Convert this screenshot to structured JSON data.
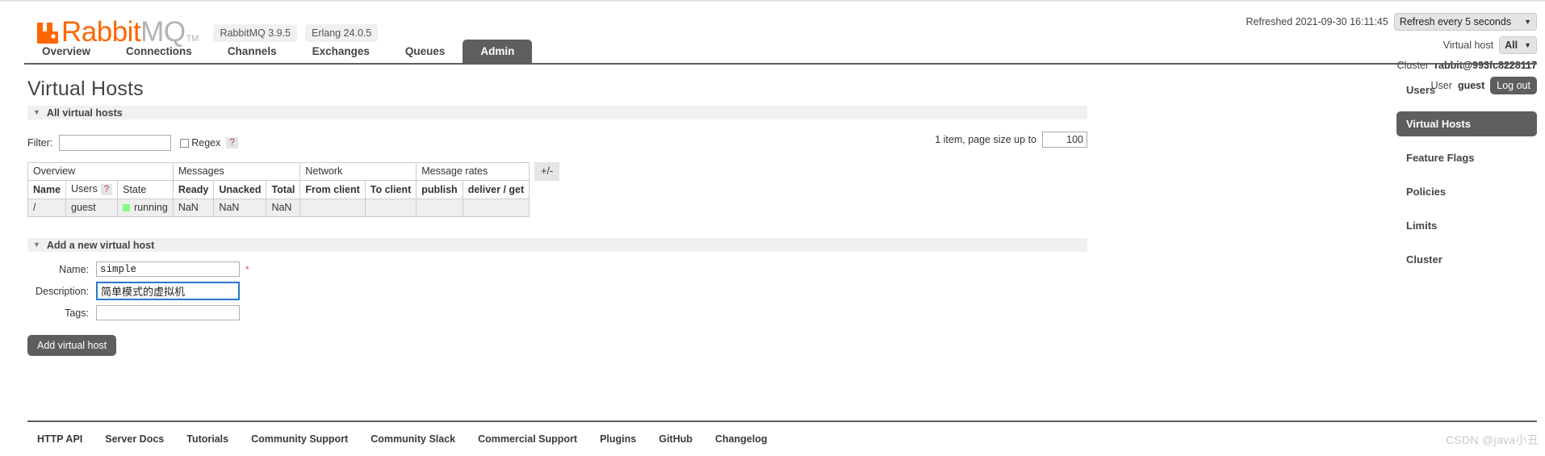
{
  "header": {
    "logo": {
      "brand_primary": "Rabbit",
      "brand_secondary": "MQ",
      "trademark": "TM",
      "icon": "rabbit-logo-icon"
    },
    "versions": {
      "rabbitmq": "RabbitMQ 3.9.5",
      "erlang": "Erlang 24.0.5"
    },
    "refreshed_text": "Refreshed 2021-09-30 16:11:45",
    "refresh_select": {
      "value": "Refresh every 5 seconds"
    },
    "vhost_label": "Virtual host",
    "vhost_select": {
      "value": "All"
    },
    "cluster_label": "Cluster",
    "cluster_name": "rabbit@993fc8228117",
    "user_label": "User",
    "user_name": "guest",
    "logout_label": "Log out"
  },
  "tabs": [
    {
      "label": "Overview",
      "active": false
    },
    {
      "label": "Connections",
      "active": false
    },
    {
      "label": "Channels",
      "active": false
    },
    {
      "label": "Exchanges",
      "active": false
    },
    {
      "label": "Queues",
      "active": false
    },
    {
      "label": "Admin",
      "active": true
    }
  ],
  "page": {
    "title": "Virtual Hosts"
  },
  "all_vhosts": {
    "section_title": "All virtual hosts",
    "filter_label": "Filter:",
    "filter_value": "",
    "filter_placeholder": "",
    "regex_label": "Regex",
    "regex_checked": false,
    "help_label": "?",
    "pager_text": "1 item, page size up to",
    "page_size": "100",
    "plus_minus_label": "+/-",
    "group_headers": [
      "Overview",
      "Messages",
      "Network",
      "Message rates"
    ],
    "columns": [
      "Name",
      "Users",
      "State",
      "Ready",
      "Unacked",
      "Total",
      "From client",
      "To client",
      "publish",
      "deliver / get"
    ],
    "users_help": "?",
    "rows": [
      {
        "name": "/",
        "users": "guest",
        "state": "running",
        "state_color": "#80ff80",
        "ready": "NaN",
        "unacked": "NaN",
        "total": "NaN",
        "from_client": "",
        "to_client": "",
        "publish": "",
        "deliver_get": ""
      }
    ]
  },
  "add_vhost": {
    "section_title": "Add a new virtual host",
    "fields": [
      {
        "label": "Name:",
        "value": "simple",
        "required": true,
        "focused": false,
        "placeholder": ""
      },
      {
        "label": "Description:",
        "value": "简单模式的虚拟机",
        "required": false,
        "focused": true,
        "placeholder": ""
      },
      {
        "label": "Tags:",
        "value": "",
        "required": false,
        "focused": false,
        "placeholder": ""
      }
    ],
    "required_marker": "*",
    "submit_label": "Add virtual host"
  },
  "right_nav": [
    {
      "label": "Users",
      "active": false
    },
    {
      "label": "Virtual Hosts",
      "active": true
    },
    {
      "label": "Feature Flags",
      "active": false
    },
    {
      "label": "Policies",
      "active": false
    },
    {
      "label": "Limits",
      "active": false
    },
    {
      "label": "Cluster",
      "active": false
    }
  ],
  "footer": {
    "links": [
      "HTTP API",
      "Server Docs",
      "Tutorials",
      "Community Support",
      "Community Slack",
      "Commercial Support",
      "Plugins",
      "GitHub",
      "Changelog"
    ]
  },
  "watermark": "CSDN @java小丑",
  "colors": {
    "brand_orange": "#ff6600",
    "dark_gray": "#5e5e5e",
    "running_green": "#80ff80",
    "focus_blue": "#2878d0"
  }
}
